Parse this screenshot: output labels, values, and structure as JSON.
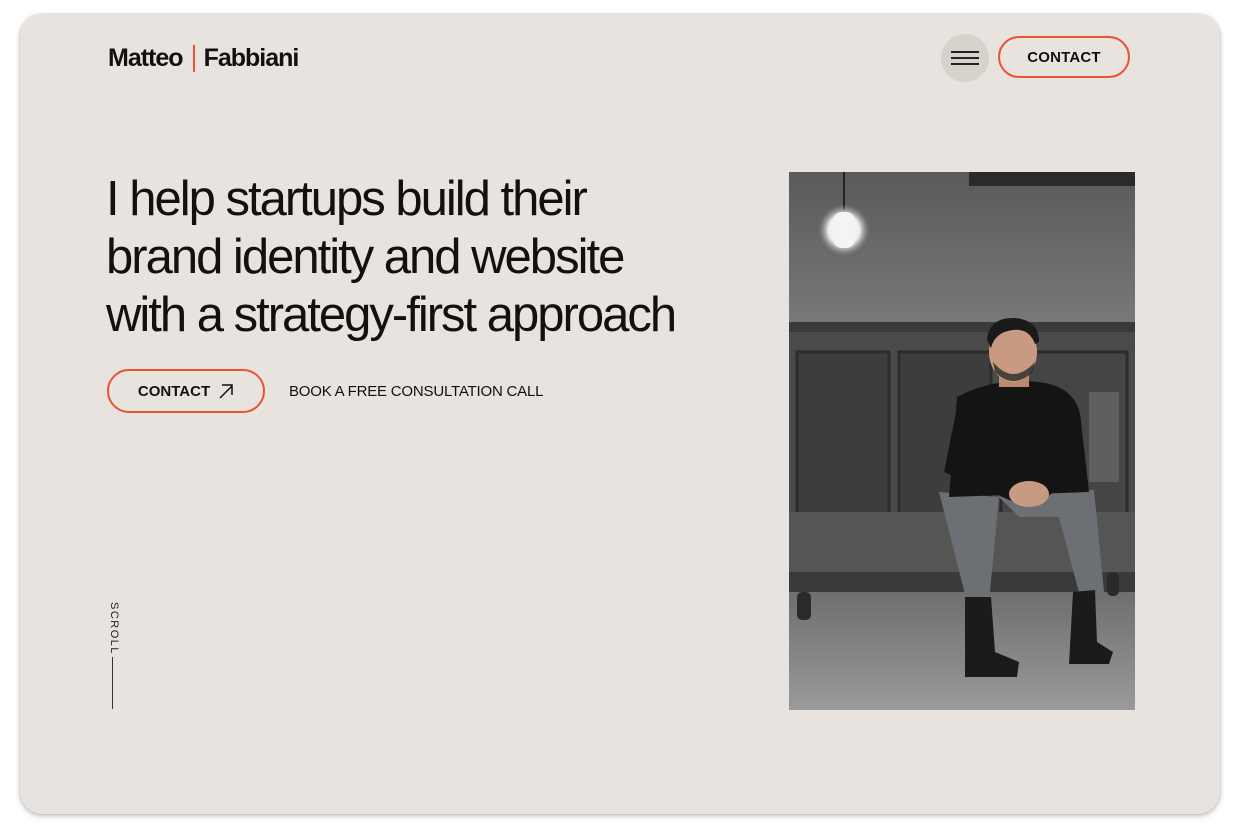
{
  "header": {
    "logo_first": "Matteo",
    "logo_last": "Fabbiani",
    "menu_icon": "hamburger-icon",
    "contact_label": "CONTACT"
  },
  "hero": {
    "headline_line1": "I help startups build their",
    "headline_line2": "brand identity and website",
    "headline_line3": "with a strategy-first approach",
    "cta_contact_label": "CONTACT",
    "cta_contact_icon": "arrow-up-right-icon",
    "cta_book_label": "BOOK A FREE CONSULTATION CALL"
  },
  "scroll": {
    "label": "SCROLL"
  },
  "colors": {
    "background": "#e8e3de",
    "accent": "#e8542f",
    "text": "#111111"
  }
}
